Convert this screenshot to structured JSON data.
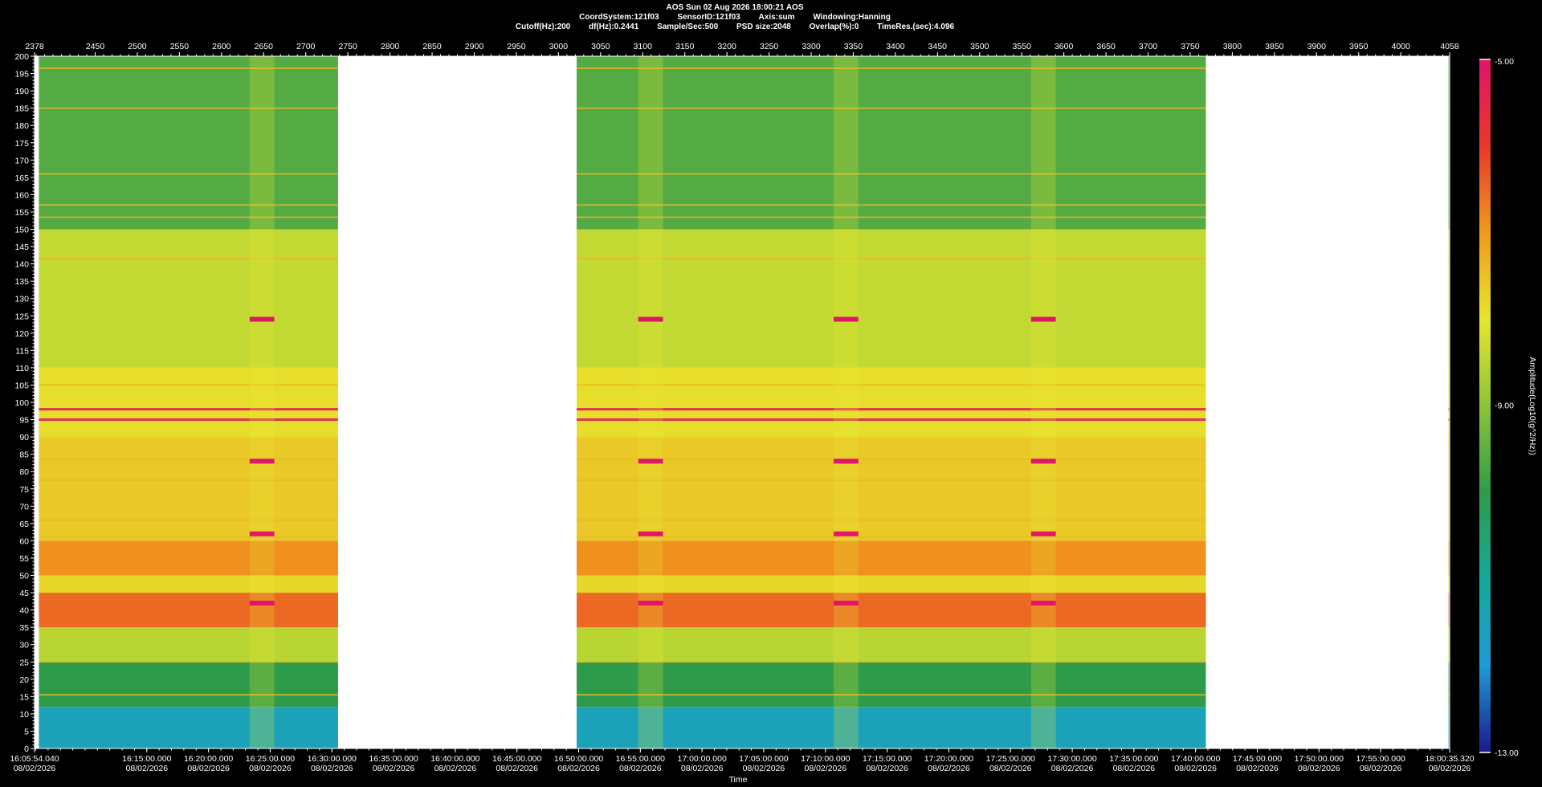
{
  "header": {
    "line1": "AOS  Sun 02 Aug 2026 18:00:21  AOS",
    "line2": [
      "CoordSystem:121f03",
      "SensorID:121f03",
      "Axis:sum",
      "Windowing:Hanning"
    ],
    "line3": [
      "Cutoff(Hz):200",
      "df(Hz):0.2441",
      "Sample/Sec:500",
      "PSD size:2048",
      "Overlap(%):0",
      "TimeRes.(sec):4.096"
    ]
  },
  "chart_data": {
    "type": "heatmap",
    "title": "AOS  Sun 02 Aug 2026 18:00:21  AOS",
    "xlabel": "Time",
    "colorbar_label": "Amplitude(Log10(g^2/Hz))",
    "colorbar_range": [
      -13.0,
      -5.0
    ],
    "colorbar_ticks": [
      "-5.00",
      "-9.00",
      "-13.00"
    ],
    "colors": [
      "#1a1a8c",
      "#1f9bd6",
      "#17a89a",
      "#2e9b4a",
      "#8cc43a",
      "#e6e62e",
      "#f09a1e",
      "#e8382a",
      "#e0156b"
    ],
    "ylim": [
      0,
      200
    ],
    "y_ticks": [
      200,
      195,
      190,
      185,
      180,
      175,
      170,
      165,
      160,
      155,
      150,
      145,
      140,
      135,
      130,
      125,
      120,
      115,
      110,
      105,
      100,
      95,
      90,
      85,
      80,
      75,
      70,
      65,
      60,
      55,
      50,
      45,
      40,
      35,
      30,
      25,
      20,
      15,
      10,
      5,
      0
    ],
    "top_axis": {
      "range": [
        2378,
        4058
      ],
      "ticks": [
        2378,
        2450,
        2500,
        2550,
        2600,
        2650,
        2700,
        2750,
        2800,
        2850,
        2900,
        2950,
        3000,
        3050,
        3100,
        3150,
        3200,
        3250,
        3300,
        3350,
        3400,
        3450,
        3500,
        3550,
        3600,
        3650,
        3700,
        3750,
        3800,
        3850,
        3900,
        3950,
        4000,
        4058
      ]
    },
    "time_axis": {
      "start": "16:05:54.040",
      "end": "18:00:35.320",
      "ticks": [
        {
          "time": "16:05:54.040",
          "date": "08/02/2026",
          "t": 0
        },
        {
          "time": "16:15:00.000",
          "date": "08/02/2026",
          "t": 545.96
        },
        {
          "time": "16:20:00.000",
          "date": "08/02/2026",
          "t": 845.96
        },
        {
          "time": "16:25:00.000",
          "date": "08/02/2026",
          "t": 1145.96
        },
        {
          "time": "16:30:00.000",
          "date": "08/02/2026",
          "t": 1445.96
        },
        {
          "time": "16:35:00.000",
          "date": "08/02/2026",
          "t": 1745.96
        },
        {
          "time": "16:40:00.000",
          "date": "08/02/2026",
          "t": 2045.96
        },
        {
          "time": "16:45:00.000",
          "date": "08/02/2026",
          "t": 2345.96
        },
        {
          "time": "16:50:00.000",
          "date": "08/02/2026",
          "t": 2645.96
        },
        {
          "time": "16:55:00.000",
          "date": "08/02/2026",
          "t": 2945.96
        },
        {
          "time": "17:00:00.000",
          "date": "08/02/2026",
          "t": 3245.96
        },
        {
          "time": "17:05:00.000",
          "date": "08/02/2026",
          "t": 3545.96
        },
        {
          "time": "17:10:00.000",
          "date": "08/02/2026",
          "t": 3845.96
        },
        {
          "time": "17:15:00.000",
          "date": "08/02/2026",
          "t": 4145.96
        },
        {
          "time": "17:20:00.000",
          "date": "08/02/2026",
          "t": 4445.96
        },
        {
          "time": "17:25:00.000",
          "date": "08/02/2026",
          "t": 4745.96
        },
        {
          "time": "17:30:00.000",
          "date": "08/02/2026",
          "t": 5045.96
        },
        {
          "time": "17:35:00.000",
          "date": "08/02/2026",
          "t": 5345.96
        },
        {
          "time": "17:40:00.000",
          "date": "08/02/2026",
          "t": 5645.96
        },
        {
          "time": "17:45:00.000",
          "date": "08/02/2026",
          "t": 5945.96
        },
        {
          "time": "17:50:00.000",
          "date": "08/02/2026",
          "t": 6245.96
        },
        {
          "time": "17:55:00.000",
          "date": "08/02/2026",
          "t": 6545.96
        },
        {
          "time": "18:00:35.320",
          "date": "08/02/2026",
          "t": 6881.28
        }
      ]
    },
    "data_segments": [
      {
        "start": "16:06:15",
        "end": "16:30:30"
      },
      {
        "start": "16:49:50",
        "end": "17:40:50"
      },
      {
        "start": "18:00:30",
        "end": "18:00:35.320"
      }
    ],
    "gaps": [
      {
        "start": "16:30:30",
        "end": "16:49:50"
      },
      {
        "start": "17:40:50",
        "end": "18:00:30"
      }
    ],
    "bands": [
      {
        "from": 0,
        "to": 12,
        "level": -11.5
      },
      {
        "from": 12,
        "to": 25,
        "level": -10.0
      },
      {
        "from": 25,
        "to": 35,
        "level": -8.5
      },
      {
        "from": 35,
        "to": 45,
        "level": -6.5
      },
      {
        "from": 45,
        "to": 50,
        "level": -7.8
      },
      {
        "from": 50,
        "to": 60,
        "level": -6.9
      },
      {
        "from": 60,
        "to": 90,
        "level": -7.6
      },
      {
        "from": 90,
        "to": 110,
        "level": -7.9
      },
      {
        "from": 110,
        "to": 150,
        "level": -8.4
      },
      {
        "from": 150,
        "to": 200,
        "level": -9.6
      }
    ],
    "tonal_lines_hz": [
      98,
      95,
      141.5,
      105,
      83.5,
      77.5,
      66,
      61,
      25,
      15.5,
      196.5,
      185,
      166,
      157,
      153.5
    ],
    "events": [
      {
        "start": "16:23:20",
        "end": "16:25:20",
        "freqs_hz": [
          124,
          83,
          62,
          42
        ]
      },
      {
        "start": "16:54:50",
        "end": "16:56:50",
        "freqs_hz": [
          124,
          83,
          62,
          42
        ]
      },
      {
        "start": "17:10:40",
        "end": "17:12:40",
        "freqs_hz": [
          124,
          83,
          62,
          42
        ]
      },
      {
        "start": "17:26:40",
        "end": "17:28:40",
        "freqs_hz": [
          124,
          83,
          62,
          42
        ]
      }
    ]
  }
}
